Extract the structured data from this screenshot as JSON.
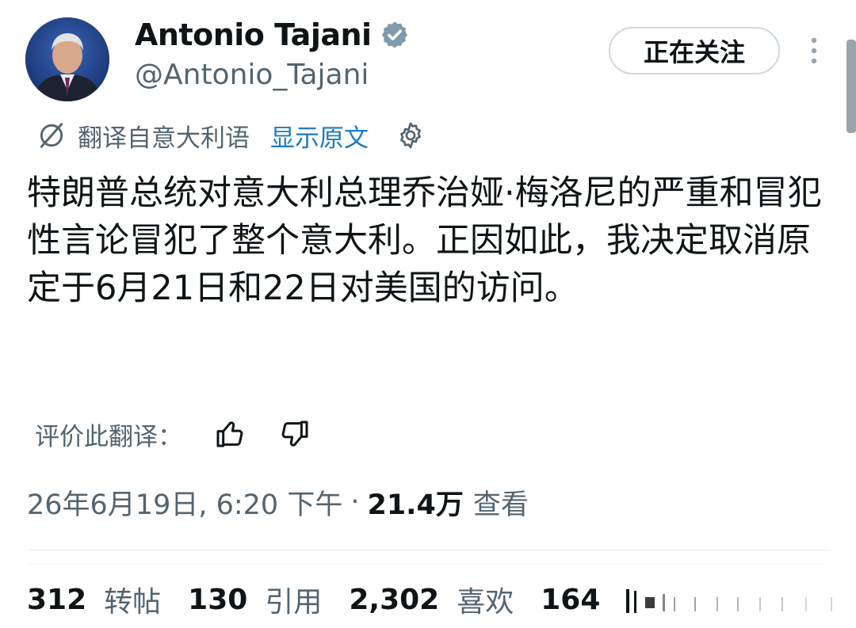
{
  "user": {
    "display_name": "Antonio Tajani",
    "handle": "@Antonio_Tajani",
    "avatar": "profile-photo",
    "verified_icon": "verified-badge-icon"
  },
  "actions": {
    "follow_label": "正在关注",
    "more_icon": "more-vertical-icon"
  },
  "translation": {
    "label": "翻译自意大利语",
    "show_original": "显示原文",
    "icon": "translate-icon",
    "settings_icon": "gear-icon"
  },
  "tweet": {
    "text": "特朗普总统对意大利总理乔治娅·梅洛尼的严重和冒犯性言论冒犯了整个意大利。正因如此，我决定取消原定于6月21日和22日对美国的访问。"
  },
  "rate": {
    "label": "评价此翻译：",
    "thumb_up_icon": "thumbs-up-icon",
    "thumb_down_icon": "thumbs-down-icon"
  },
  "meta": {
    "timestamp": "26年6月19日, 6:20 下午",
    "separator": "·",
    "views_count": "21.4万",
    "views_label": "查看"
  },
  "stats": [
    {
      "count": "312",
      "label": "转帖"
    },
    {
      "count": "130",
      "label": "引用"
    },
    {
      "count": "2,302",
      "label": "喜欢"
    },
    {
      "count": "164",
      "label": ""
    }
  ],
  "colors": {
    "text": "#0f1419",
    "secondary": "#536471",
    "link": "#1d7bc2",
    "border": "#cfd9de"
  }
}
